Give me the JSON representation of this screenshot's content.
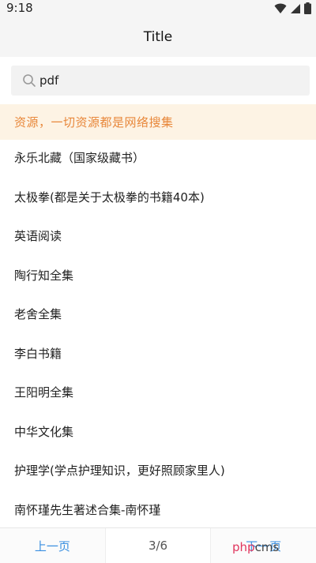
{
  "status_bar": {
    "time": "9:18",
    "icons": [
      "wifi-icon",
      "signal-icon",
      "battery-icon"
    ]
  },
  "header": {
    "title": "Title"
  },
  "search": {
    "value": "pdf",
    "icon": "search-icon"
  },
  "notice": {
    "text": "资源，一切资源都是网络搜集",
    "color": "#e8873a",
    "background": "#fdf3e4"
  },
  "list": {
    "items": [
      "永乐北藏（国家级藏书）",
      "太极拳(都是关于太极拳的书籍40本)",
      "英语阅读",
      "陶行知全集",
      "老舍全集",
      "李白书籍",
      "王阳明全集",
      "中华文化集",
      "护理学(学点护理知识，更好照顾家里人)",
      "南怀瑾先生著述合集-南怀瑾"
    ]
  },
  "pager": {
    "prev_label": "上一页",
    "page_indicator": "3/6",
    "next_label": "下一页",
    "accent": "#3a8fe0"
  },
  "watermark": {
    "text": "phpcms"
  }
}
